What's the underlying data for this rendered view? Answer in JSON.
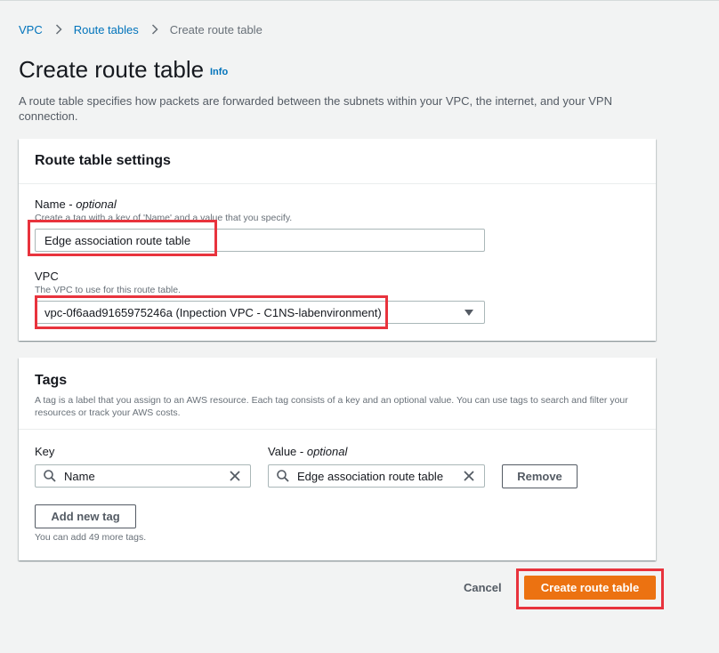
{
  "breadcrumb": {
    "items": [
      "VPC",
      "Route tables"
    ],
    "current": "Create route table"
  },
  "page": {
    "title": "Create route table",
    "info": "Info",
    "description": "A route table specifies how packets are forwarded between the subnets within your VPC, the internet, and your VPN connection."
  },
  "settings": {
    "title": "Route table settings",
    "name_label": "Name - ",
    "name_label_optional": "optional",
    "name_desc": "Create a tag with a key of 'Name' and a value that you specify.",
    "name_value": "Edge association route table",
    "vpc_label": "VPC",
    "vpc_desc": "The VPC to use for this route table.",
    "vpc_value": "vpc-0f6aad9165975246a (Inpection VPC - C1NS-labenvironment)"
  },
  "tags": {
    "title": "Tags",
    "description": "A tag is a label that you assign to an AWS resource. Each tag consists of a key and an optional value. You can use tags to search and filter your resources or track your AWS costs.",
    "key_label": "Key",
    "value_label": "Value - ",
    "value_label_optional": "optional",
    "key_value": "Name",
    "value_value": "Edge association route table",
    "remove_label": "Remove",
    "add_label": "Add new tag",
    "hint": "You can add 49 more tags."
  },
  "footer": {
    "cancel_label": "Cancel",
    "create_label": "Create route table"
  },
  "colors": {
    "link": "#0073bb",
    "primary": "#ec7211",
    "highlight": "#e8333d"
  }
}
